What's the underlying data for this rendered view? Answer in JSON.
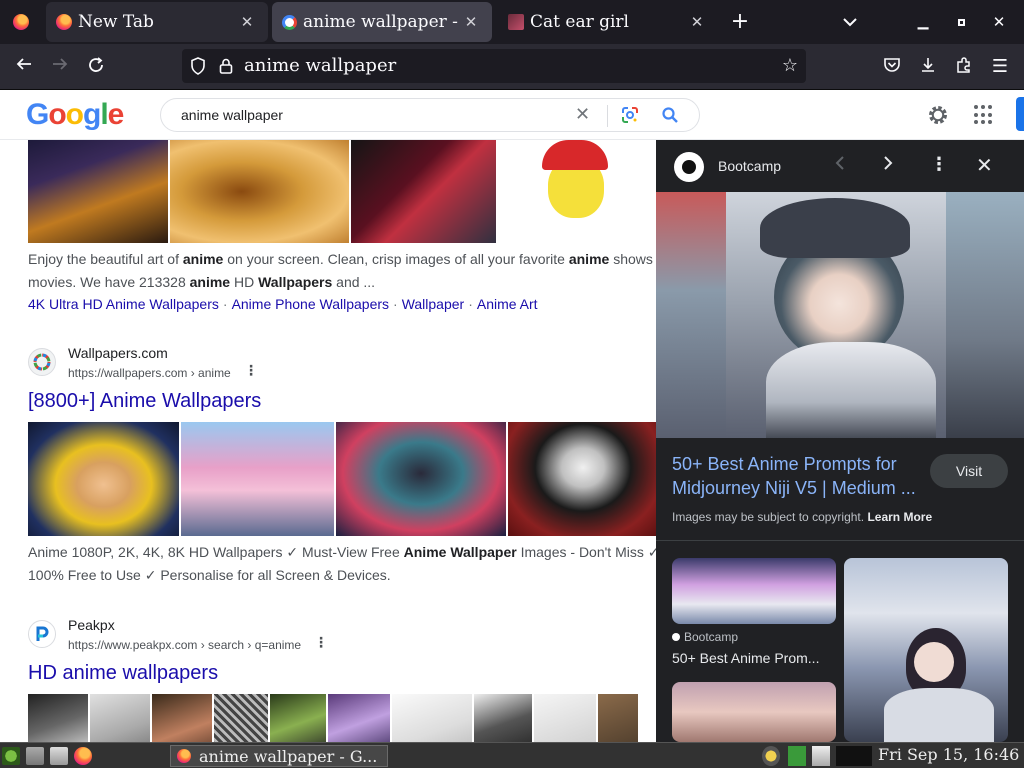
{
  "browser": {
    "tabs": [
      {
        "title": "New Tab",
        "active": false
      },
      {
        "title": "anime wallpaper - G",
        "active": true
      },
      {
        "title": "Cat ear girl",
        "active": false
      }
    ],
    "new_tab_symbol": "+",
    "url": "anime wallpaper",
    "icons": [
      "firefox-menu-icon",
      "back-icon",
      "forward-icon",
      "reload-icon",
      "shield-icon",
      "lock-icon",
      "bookmark-star-icon",
      "pocket-icon",
      "download-icon",
      "extensions-icon",
      "hamburger-menu-icon"
    ]
  },
  "google": {
    "logo": [
      "G",
      "o",
      "o",
      "g",
      "l",
      "e"
    ],
    "logo_colors": [
      "#4285f4",
      "#ea4335",
      "#fbbc05",
      "#4285f4",
      "#34a853",
      "#ea4335"
    ],
    "query": "anime wallpaper"
  },
  "results": {
    "snippet1": {
      "line1_parts": [
        "Enjoy the beautiful art of ",
        "anime",
        " on your screen. Clean, crisp images of all your favorite ",
        "anime",
        " shows"
      ],
      "line2_parts": [
        "movies. We have 213328 ",
        "anime",
        " HD ",
        "Wallpapers",
        " and ..."
      ]
    },
    "sitelinks": [
      "4K Ultra HD Anime Wallpapers",
      "Anime Phone Wallpapers",
      "Wallpaper",
      "Anime Art"
    ],
    "r2": {
      "site": "Wallpapers.com",
      "url": "https://wallpapers.com › anime",
      "title": "[8800+] Anime Wallpapers",
      "snippet_line1_parts": [
        "Anime 1080P, 2K, 4K, 8K HD Wallpapers ✓ Must-View Free ",
        "Anime Wallpaper",
        " Images - Don't Miss ✓"
      ],
      "snippet_line2": "100% Free to Use ✓ Personalise for all Screen & Devices."
    },
    "r3": {
      "site": "Peakpx",
      "url": "https://www.peakpx.com › search › q=anime",
      "title": "HD anime wallpapers"
    }
  },
  "panel": {
    "source": "Bootcamp",
    "title": "50+ Best Anime Prompts for Midjourney Niji V5 | Medium ...",
    "visit": "Visit",
    "copyright_text": "Images may be subject to copyright. ",
    "learn_more": "Learn More",
    "related": {
      "source": "Bootcamp",
      "title": "50+ Best Anime Prom..."
    }
  },
  "taskbar": {
    "task_title": "anime wallpaper - G...",
    "clock": "Fri Sep 15, 16:46"
  }
}
